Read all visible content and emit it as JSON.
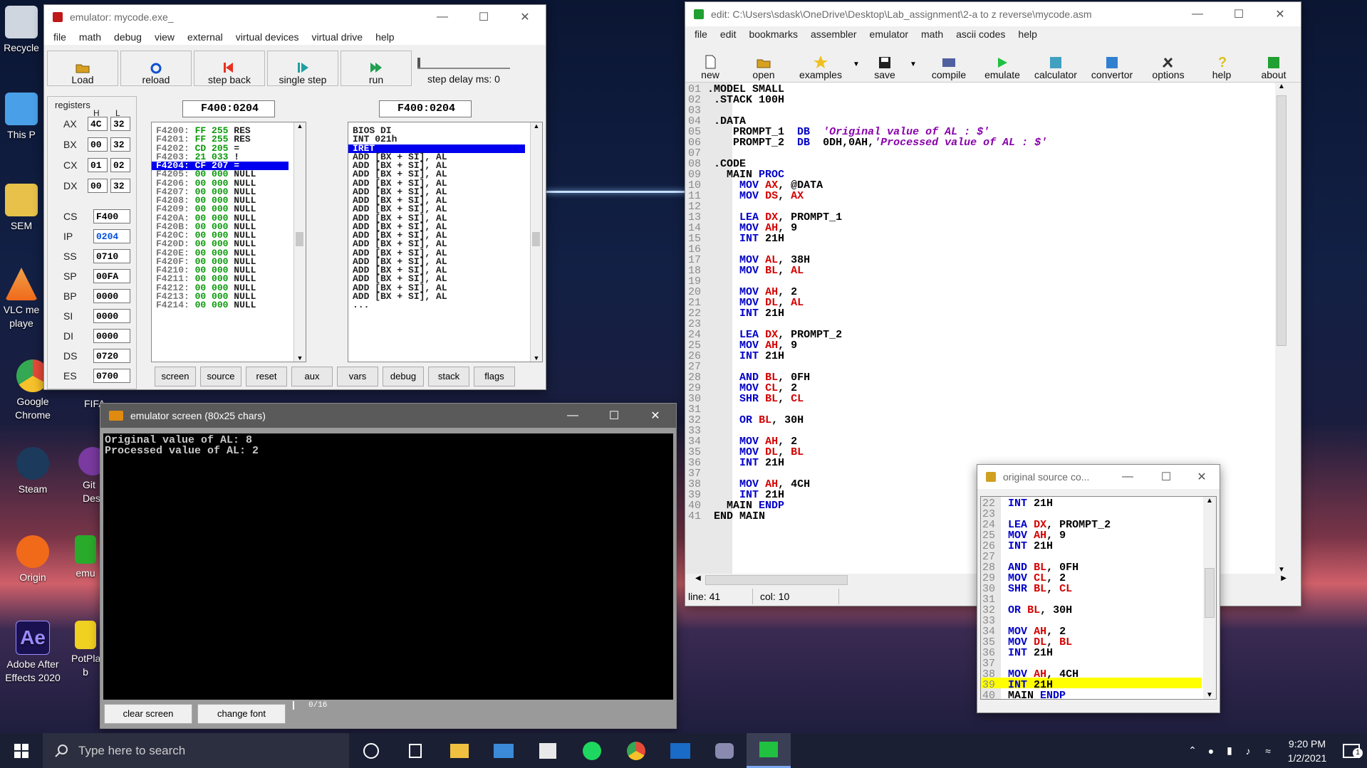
{
  "desktop": {
    "icons": [
      {
        "label": "Recycle",
        "color": "#cfd6e0"
      },
      {
        "label": "This P",
        "color": "#4aa0e8"
      },
      {
        "label": "SEM",
        "color": "#e8c14a"
      },
      {
        "label": "VLC me playe",
        "color": "#f08a1a"
      },
      {
        "label": "Google Chrome",
        "color": "#e84a3a"
      },
      {
        "label": "Steam",
        "color": "#1b3a5c"
      },
      {
        "label": "Origin",
        "color": "#f06a1a"
      },
      {
        "label": "Adobe After Effects 2020",
        "color": "#1a1250"
      },
      {
        "label": "FIFA",
        "color": "#333"
      },
      {
        "label": "Git Des",
        "color": "#7a3aa0"
      },
      {
        "label": "emu",
        "color": "#2aaa2a"
      },
      {
        "label": "PotPla b",
        "color": "#f0d020"
      }
    ]
  },
  "emulator": {
    "title": "emulator: mycode.exe_",
    "menu": [
      "file",
      "math",
      "debug",
      "view",
      "external",
      "virtual devices",
      "virtual drive",
      "help"
    ],
    "toolbar": {
      "load": "Load",
      "reload": "reload",
      "step_back": "step back",
      "single_step": "single step",
      "run": "run",
      "step_delay": "step delay ms: 0"
    },
    "registers_label": "registers",
    "h_label": "H",
    "l_label": "L",
    "regs8": [
      {
        "name": "AX",
        "h": "4C",
        "l": "32"
      },
      {
        "name": "BX",
        "h": "00",
        "l": "32"
      },
      {
        "name": "CX",
        "h": "01",
        "l": "02"
      },
      {
        "name": "DX",
        "h": "00",
        "l": "32"
      }
    ],
    "regs16": [
      {
        "name": "CS",
        "val": "F400"
      },
      {
        "name": "IP",
        "val": "0204"
      },
      {
        "name": "SS",
        "val": "0710"
      },
      {
        "name": "SP",
        "val": "00FA"
      },
      {
        "name": "BP",
        "val": "0000"
      },
      {
        "name": "SI",
        "val": "0000"
      },
      {
        "name": "DI",
        "val": "0000"
      },
      {
        "name": "DS",
        "val": "0720"
      },
      {
        "name": "ES",
        "val": "0700"
      }
    ],
    "addr_left": "F400:0204",
    "addr_right": "F400:0204",
    "memory": [
      {
        "addr": "F4200:",
        "hex": "FF",
        "dec": "255",
        "chr": "RES"
      },
      {
        "addr": "F4201:",
        "hex": "FF",
        "dec": "255",
        "chr": "RES"
      },
      {
        "addr": "F4202:",
        "hex": "CD",
        "dec": "205",
        "chr": "="
      },
      {
        "addr": "F4203:",
        "hex": "21",
        "dec": "033",
        "chr": "!"
      },
      {
        "addr": "F4204:",
        "hex": "CF",
        "dec": "207",
        "chr": "="
      },
      {
        "addr": "F4205:",
        "hex": "00",
        "dec": "000",
        "chr": "NULL"
      },
      {
        "addr": "F4206:",
        "hex": "00",
        "dec": "000",
        "chr": "NULL"
      },
      {
        "addr": "F4207:",
        "hex": "00",
        "dec": "000",
        "chr": "NULL"
      },
      {
        "addr": "F4208:",
        "hex": "00",
        "dec": "000",
        "chr": "NULL"
      },
      {
        "addr": "F4209:",
        "hex": "00",
        "dec": "000",
        "chr": "NULL"
      },
      {
        "addr": "F420A:",
        "hex": "00",
        "dec": "000",
        "chr": "NULL"
      },
      {
        "addr": "F420B:",
        "hex": "00",
        "dec": "000",
        "chr": "NULL"
      },
      {
        "addr": "F420C:",
        "hex": "00",
        "dec": "000",
        "chr": "NULL"
      },
      {
        "addr": "F420D:",
        "hex": "00",
        "dec": "000",
        "chr": "NULL"
      },
      {
        "addr": "F420E:",
        "hex": "00",
        "dec": "000",
        "chr": "NULL"
      },
      {
        "addr": "F420F:",
        "hex": "00",
        "dec": "000",
        "chr": "NULL"
      },
      {
        "addr": "F4210:",
        "hex": "00",
        "dec": "000",
        "chr": "NULL"
      },
      {
        "addr": "F4211:",
        "hex": "00",
        "dec": "000",
        "chr": "NULL"
      },
      {
        "addr": "F4212:",
        "hex": "00",
        "dec": "000",
        "chr": "NULL"
      },
      {
        "addr": "F4213:",
        "hex": "00",
        "dec": "000",
        "chr": "NULL"
      },
      {
        "addr": "F4214:",
        "hex": "00",
        "dec": "000",
        "chr": "NULL"
      }
    ],
    "memory_selected": 4,
    "disasm": [
      "BIOS DI",
      "INT 021h",
      "IRET",
      "ADD [BX + SI], AL",
      "ADD [BX + SI], AL",
      "ADD [BX + SI], AL",
      "ADD [BX + SI], AL",
      "ADD [BX + SI], AL",
      "ADD [BX + SI], AL",
      "ADD [BX + SI], AL",
      "ADD [BX + SI], AL",
      "ADD [BX + SI], AL",
      "ADD [BX + SI], AL",
      "ADD [BX + SI], AL",
      "ADD [BX + SI], AL",
      "ADD [BX + SI], AL",
      "ADD [BX + SI], AL",
      "ADD [BX + SI], AL",
      "ADD [BX + SI], AL",
      "ADD [BX + SI], AL",
      "..."
    ],
    "disasm_selected": 2,
    "bottom_buttons": [
      "screen",
      "source",
      "reset",
      "aux",
      "vars",
      "debug",
      "stack",
      "flags"
    ]
  },
  "screen_win": {
    "title": "emulator screen (80x25 chars)",
    "lines": [
      "Original value of AL: 8",
      "Processed value of AL: 2"
    ],
    "clear": "clear screen",
    "font": "change font",
    "pos": "0/16"
  },
  "editor": {
    "title": "edit: C:\\Users\\sdask\\OneDrive\\Desktop\\Lab_assignment\\2-a to z reverse\\mycode.asm",
    "menu": [
      "file",
      "edit",
      "bookmarks",
      "assembler",
      "emulator",
      "math",
      "ascii codes",
      "help"
    ],
    "toolbar": [
      "new",
      "open",
      "examples",
      "save",
      "compile",
      "emulate",
      "calculator",
      "convertor",
      "options",
      "help",
      "about"
    ],
    "status_line": "line: 41",
    "status_col": "col: 10"
  },
  "source_win": {
    "title": "original source co..."
  },
  "taskbar": {
    "search_placeholder": "Type here to search",
    "time": "9:20 PM",
    "date": "1/2/2021",
    "notif_count": "1"
  }
}
